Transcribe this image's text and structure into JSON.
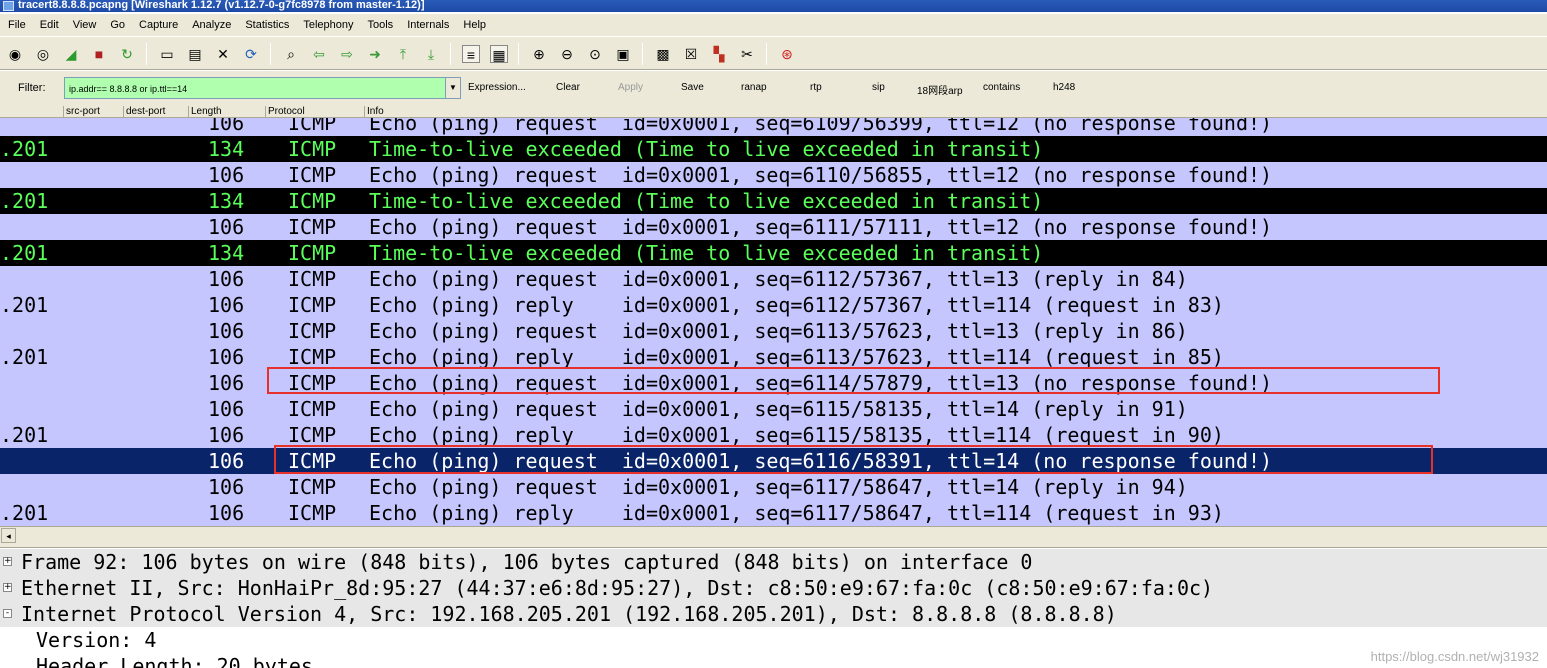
{
  "window": {
    "title": "tracert8.8.8.8.pcapng  [Wireshark 1.12.7  (v1.12.7-0-g7fc8978 from master-1.12)]"
  },
  "menu": [
    "File",
    "Edit",
    "View",
    "Go",
    "Capture",
    "Analyze",
    "Statistics",
    "Telephony",
    "Tools",
    "Internals",
    "Help"
  ],
  "filter": {
    "label": "Filter:",
    "value": "ip.addr== 8.8.8.8 or ip.ttl==14",
    "buttons": [
      "Expression...",
      "Clear",
      "Apply",
      "Save",
      "ranap",
      "rtp",
      "sip",
      "18网段arp",
      "contains",
      "h248"
    ]
  },
  "columns": [
    "src-port",
    "dest-port",
    "Length",
    "Protocol",
    "Info"
  ],
  "packets": [
    {
      "src": "",
      "len": "106",
      "proto": "ICMP",
      "info": "Echo (ping) request  id=0x0001, seq=6109/56399, ttl=12 (no response found!)",
      "kind": "req"
    },
    {
      "src": ".201",
      "len": "134",
      "proto": "ICMP",
      "info": "Time-to-live exceeded (Time to live exceeded in transit)",
      "kind": "ttl"
    },
    {
      "src": "",
      "len": "106",
      "proto": "ICMP",
      "info": "Echo (ping) request  id=0x0001, seq=6110/56855, ttl=12 (no response found!)",
      "kind": "req"
    },
    {
      "src": ".201",
      "len": "134",
      "proto": "ICMP",
      "info": "Time-to-live exceeded (Time to live exceeded in transit)",
      "kind": "ttl"
    },
    {
      "src": "",
      "len": "106",
      "proto": "ICMP",
      "info": "Echo (ping) request  id=0x0001, seq=6111/57111, ttl=12 (no response found!)",
      "kind": "req"
    },
    {
      "src": ".201",
      "len": "134",
      "proto": "ICMP",
      "info": "Time-to-live exceeded (Time to live exceeded in transit)",
      "kind": "ttl"
    },
    {
      "src": "",
      "len": "106",
      "proto": "ICMP",
      "info": "Echo (ping) request  id=0x0001, seq=6112/57367, ttl=13 (reply in 84)",
      "kind": "req"
    },
    {
      "src": ".201",
      "len": "106",
      "proto": "ICMP",
      "info": "Echo (ping) reply    id=0x0001, seq=6112/57367, ttl=114 (request in 83)",
      "kind": "rep"
    },
    {
      "src": "",
      "len": "106",
      "proto": "ICMP",
      "info": "Echo (ping) request  id=0x0001, seq=6113/57623, ttl=13 (reply in 86)",
      "kind": "req"
    },
    {
      "src": ".201",
      "len": "106",
      "proto": "ICMP",
      "info": "Echo (ping) reply    id=0x0001, seq=6113/57623, ttl=114 (request in 85)",
      "kind": "rep"
    },
    {
      "src": "",
      "len": "106",
      "proto": "ICMP",
      "info": "Echo (ping) request  id=0x0001, seq=6114/57879, ttl=13 (no response found!)",
      "kind": "req"
    },
    {
      "src": "",
      "len": "106",
      "proto": "ICMP",
      "info": "Echo (ping) request  id=0x0001, seq=6115/58135, ttl=14 (reply in 91)",
      "kind": "req"
    },
    {
      "src": ".201",
      "len": "106",
      "proto": "ICMP",
      "info": "Echo (ping) reply    id=0x0001, seq=6115/58135, ttl=114 (request in 90)",
      "kind": "rep"
    },
    {
      "src": "",
      "len": "106",
      "proto": "ICMP",
      "info": "Echo (ping) request  id=0x0001, seq=6116/58391, ttl=14 (no response found!)",
      "kind": "sel"
    },
    {
      "src": "",
      "len": "106",
      "proto": "ICMP",
      "info": "Echo (ping) request  id=0x0001, seq=6117/58647, ttl=14 (reply in 94)",
      "kind": "req"
    },
    {
      "src": ".201",
      "len": "106",
      "proto": "ICMP",
      "info": "Echo (ping) reply    id=0x0001, seq=6117/58647, ttl=114 (request in 93)",
      "kind": "rep"
    }
  ],
  "details": [
    {
      "text": "Frame 92: 106 bytes on wire (848 bits), 106 bytes captured (848 bits) on interface 0",
      "expander": "+"
    },
    {
      "text": "Ethernet II, Src: HonHaiPr_8d:95:27 (44:37:e6:8d:95:27), Dst: c8:50:e9:67:fa:0c (c8:50:e9:67:fa:0c)",
      "expander": "+"
    },
    {
      "text": "Internet Protocol Version 4, Src: 192.168.205.201 (192.168.205.201), Dst: 8.8.8.8 (8.8.8.8)",
      "expander": "-"
    },
    {
      "text": "Version: 4",
      "expander": ""
    },
    {
      "text": "Header Length: 20 bytes",
      "expander": ""
    }
  ],
  "watermark": "https://blog.csdn.net/wj31932",
  "colors": {
    "request_bg": "#c6c6ff",
    "ttl_bg": "#000000",
    "ttl_fg": "#5aff5a",
    "selected_bg": "#0a246a",
    "filter_valid_bg": "#afffaf",
    "highlight_box": "#e8302b"
  }
}
